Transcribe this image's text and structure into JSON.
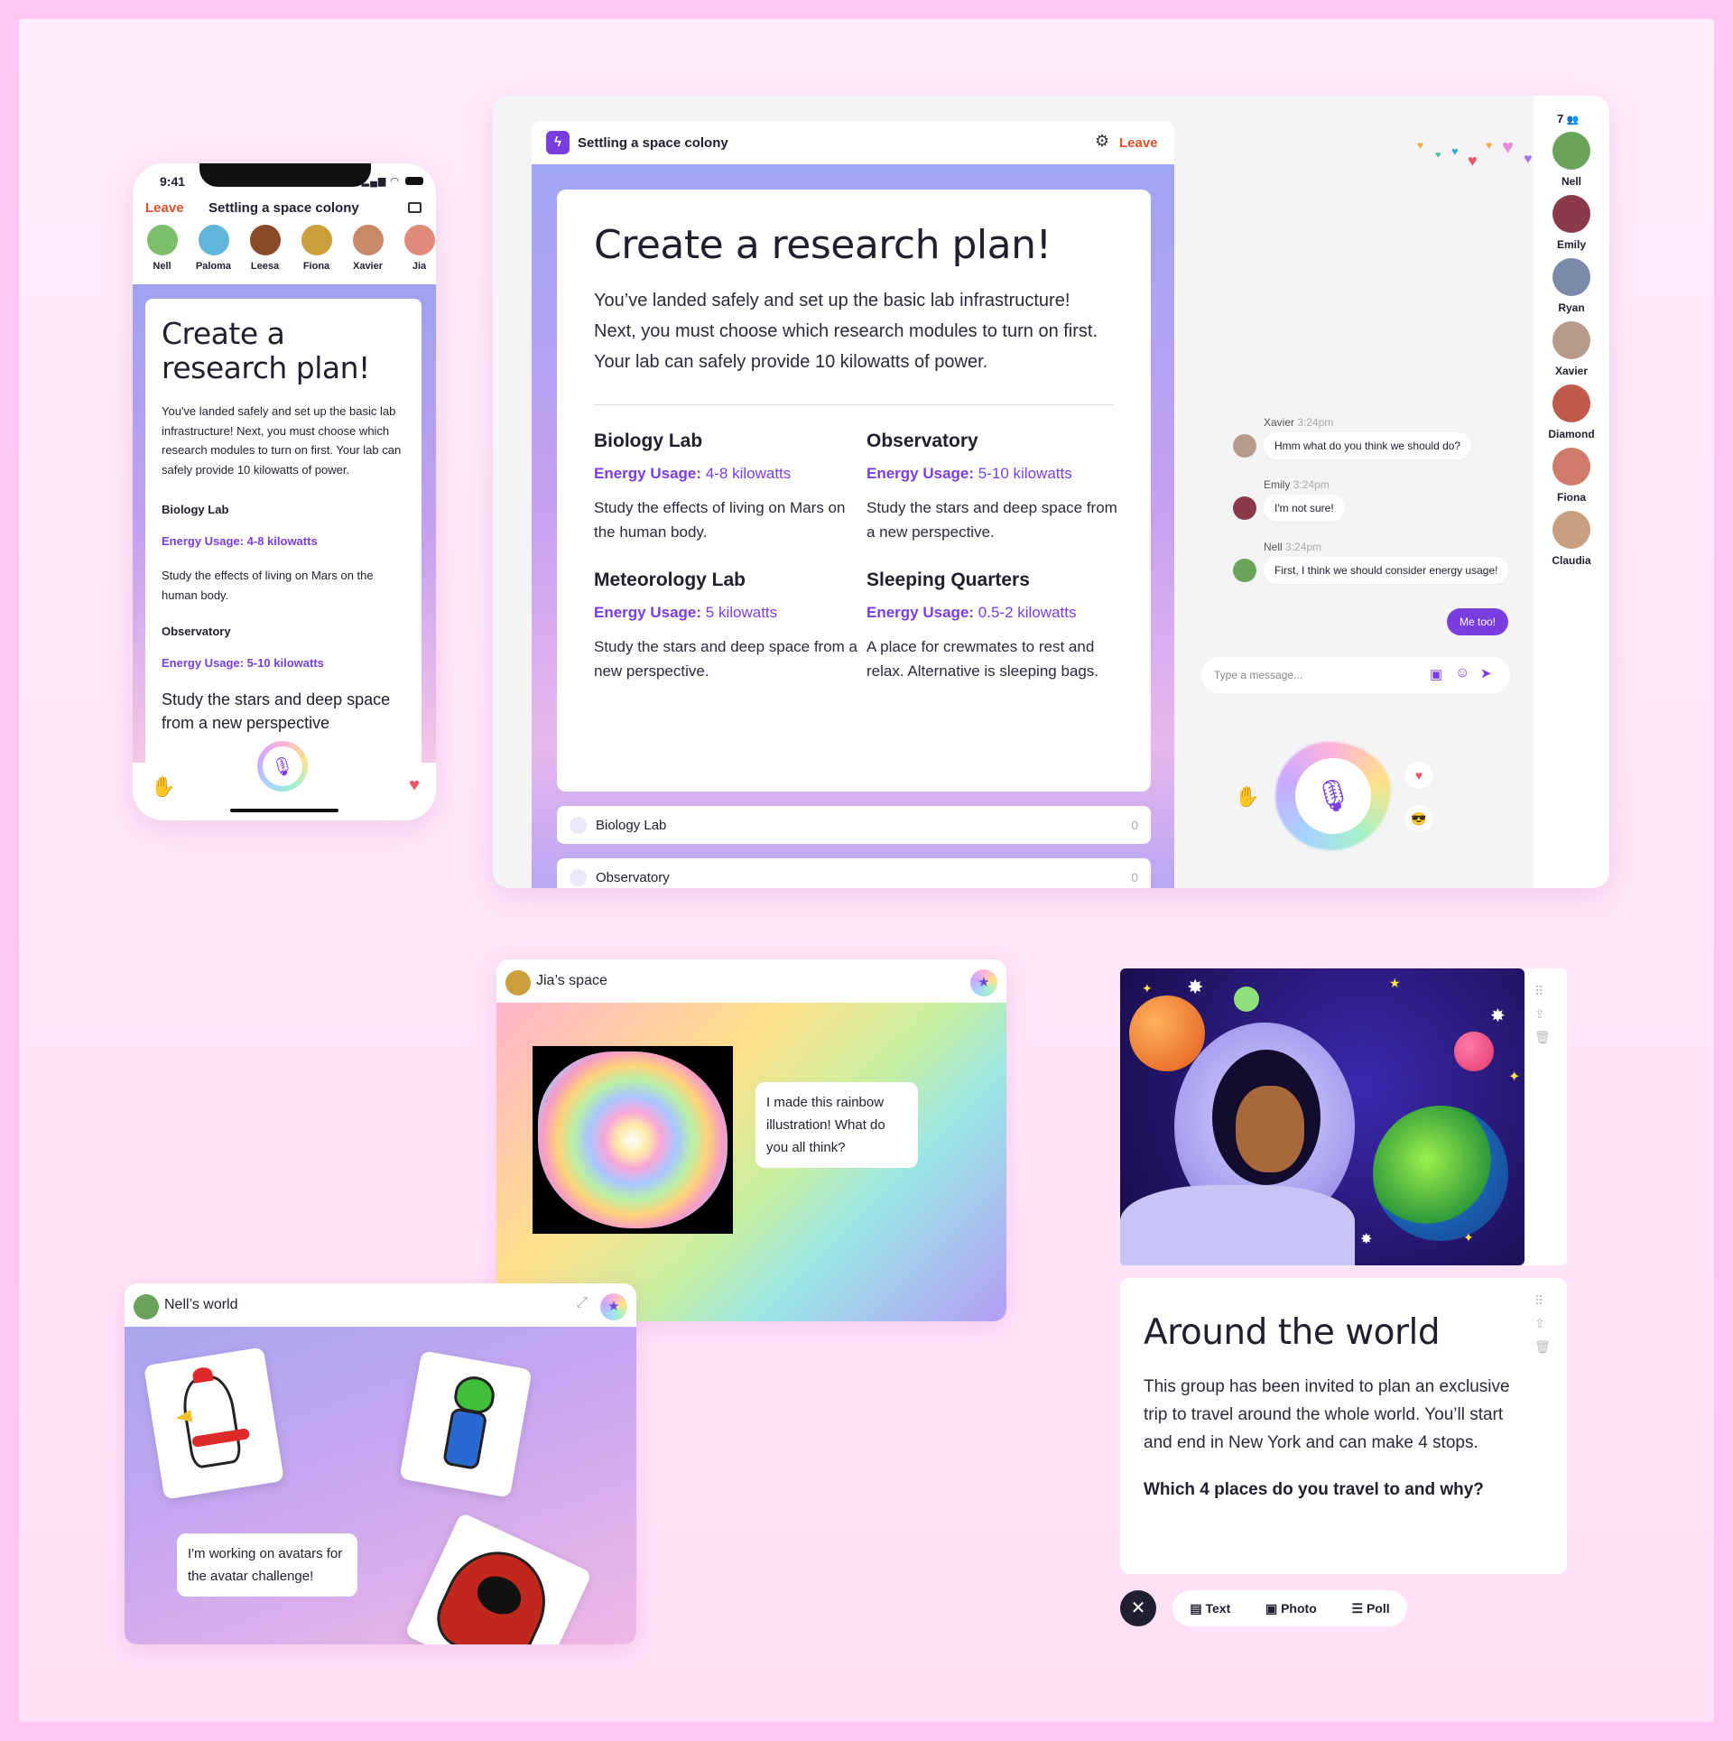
{
  "phone": {
    "time": "9:41",
    "leave": "Leave",
    "title": "Settling a space colony",
    "participants": [
      {
        "name": "Nell",
        "color": "#7bbf6a"
      },
      {
        "name": "Paloma",
        "color": "#5fb6d9"
      },
      {
        "name": "Leesa",
        "color": "#8a4a2a"
      },
      {
        "name": "Fiona",
        "color": "#c9a03a"
      },
      {
        "name": "Xavier",
        "color": "#c98a6a"
      },
      {
        "name": "Jia",
        "color": "#e08a7a"
      }
    ],
    "card": {
      "heading": "Create a research plan!",
      "intro": "You've landed safely and set up the basic lab infrastructure! Next, you must choose which research modules to turn on first. Your lab can safely provide 10 kilowatts of power.",
      "sec1_title": "Biology Lab",
      "sec1_energy": "Energy Usage: 4-8 kilowatts",
      "sec1_desc": "Study the effects of living on Mars on the human body.",
      "sec2_title": "Observatory",
      "sec2_energy": "Energy Usage: 5-10 kilowatts",
      "sec2_desc": "Study the stars and deep space from a new perspective"
    }
  },
  "desktop": {
    "title": "Settling a space colony",
    "leave": "Leave",
    "heading": "Create a research plan!",
    "intro": "You’ve landed safely and set up the basic lab infrastructure! Next, you must choose which research modules to turn on first. Your lab can safely provide 10 kilowatts of power.",
    "energy_label": "Energy Usage:",
    "modules": [
      {
        "title": "Biology Lab",
        "energy": "4-8 kilowatts",
        "desc": "Study the effects of living on Mars on the human body."
      },
      {
        "title": "Observatory",
        "energy": "5-10 kilowatts",
        "desc": "Study the stars and deep space from a new perspective."
      },
      {
        "title": "Meteorology Lab",
        "energy": "5 kilowatts",
        "desc": "Study the stars and deep space from a new perspective."
      },
      {
        "title": "Sleeping Quarters",
        "energy": "0.5-2 kilowatts",
        "desc": "A place for crewmates to rest and relax. Alternative is sleeping bags."
      }
    ],
    "options": [
      {
        "label": "Biology Lab",
        "count": "0"
      },
      {
        "label": "Observatory",
        "count": "0"
      }
    ],
    "participant_count": "7",
    "people": [
      {
        "name": "Nell",
        "color": "#6aa35a"
      },
      {
        "name": "Emily",
        "color": "#8a3a4a"
      },
      {
        "name": "Ryan",
        "color": "#7a8aa8"
      },
      {
        "name": "Xavier",
        "color": "#b89a8a"
      },
      {
        "name": "Diamond",
        "color": "#c05a4a"
      },
      {
        "name": "Fiona",
        "color": "#d07a6a"
      },
      {
        "name": "Claudia",
        "color": "#c8a080"
      }
    ],
    "chat": [
      {
        "name": "Xavier",
        "time": "3:24pm",
        "text": "Hmm what do you think we should do?"
      },
      {
        "name": "Emily",
        "time": "3:24pm",
        "text": "I'm not sure!"
      },
      {
        "name": "Nell",
        "time": "3:24pm",
        "text": "First, I think we should consider energy usage!"
      }
    ],
    "my_message": "Me too!",
    "input_placeholder": "Type a message..."
  },
  "jia": {
    "title": "Jia’s space",
    "message": "I made this rainbow illustration! What do you all think?"
  },
  "nell": {
    "title": "Nell’s world",
    "message": "I'm working on avatars for the avatar challenge!"
  },
  "around": {
    "heading": "Around the world",
    "body": "This group has been invited to plan an exclusive trip to travel around the whole world. You’ll start and end in New York and can make 4 stops.",
    "question": "Which 4 places do you travel to and why?",
    "tools": [
      "Text",
      "Photo",
      "Poll"
    ]
  },
  "colors": {
    "accent": "#7a3ee0",
    "leave": "#e2512b"
  }
}
